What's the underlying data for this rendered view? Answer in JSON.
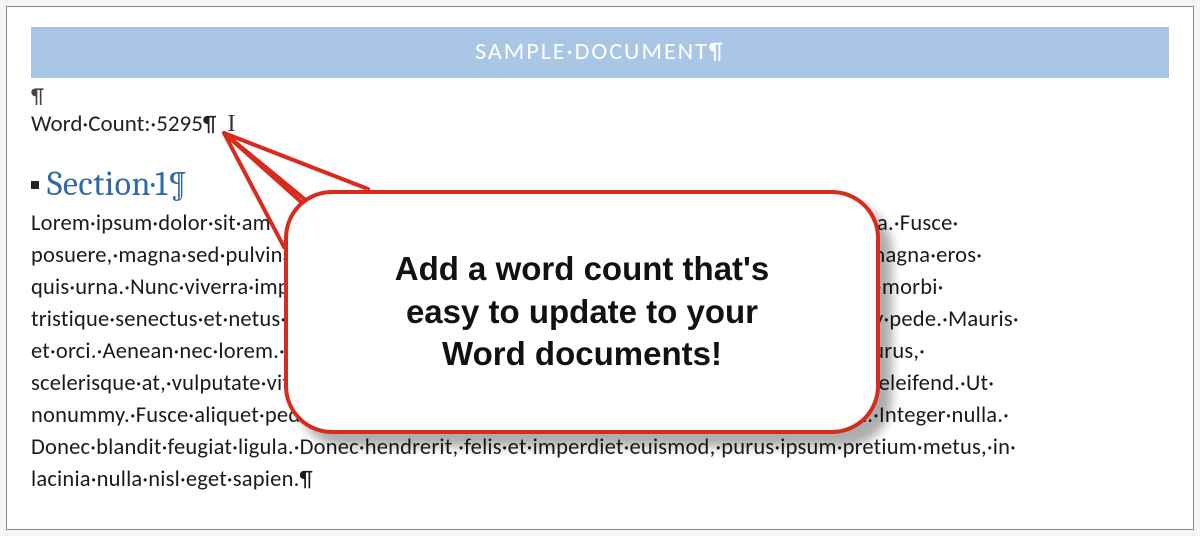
{
  "title_banner": "SAMPLE·DOCUMENT¶",
  "empty_paragraph_mark": "¶",
  "word_count_line": "Word·Count:·5295¶",
  "text_cursor_glyph": "I",
  "section": {
    "heading": "Section·1¶",
    "body": "Lorem·ipsum·dolor·sit·amet,·consectetuer·adipiscing·elit.·Maecenas·porttitor·congue·massa.·Fusce· posuere,·magna·sed·pulvinar·ultricies,·purus·lectus·malesuada·libero,·sit·amet·commodo·magna·eros· quis·urna.·Nunc·viverra·imperdiet·enim.·Fusce·est.·Vivamus·a·tellus.·Pellentesque·habitant·morbi· tristique·senectus·et·netus·et·malesuada·fames·ac·turpis·egestas.·Proin·pharetra·nonummy·pede.·Mauris· et·orci.·Aenean·nec·lorem.·In·porttitor.·Donec·laoreet·nonummy·augue.·Suspendisse·dui·purus,· scelerisque·at,·vulputate·vitae,·pretium·mattis,·nunc.·Mauris·eget·neque·at·sem·venenatis·eleifend.·Ut· nonummy.·Fusce·aliquet·pede·non·pede.·Suspendisse·dapibus·lorem·pellentesque·magna.·Integer·nulla.· Donec·blandit·feugiat·ligula.·Donec·hendrerit,·felis·et·imperdiet·euismod,·purus·ipsum·pretium·metus,·in· lacinia·nulla·nisl·eget·sapien.¶"
  },
  "callout": {
    "line1": "Add a word count that's",
    "line2": "easy to update to your",
    "line3": "Word documents!"
  },
  "colors": {
    "banner_bg": "#a9c6e7",
    "heading": "#2f6aa8",
    "callout_border": "#d82a1d"
  }
}
